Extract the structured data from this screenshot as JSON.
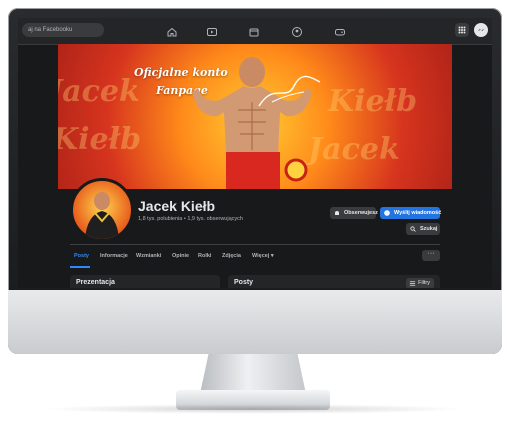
{
  "topbar": {
    "search_placeholder": "aj na Facebooku",
    "nav_icons": [
      "home-icon",
      "watch-icon",
      "marketplace-icon",
      "groups-icon",
      "gaming-icon"
    ],
    "right_icons": [
      "menu-grid-icon",
      "messenger-icon"
    ]
  },
  "cover": {
    "tagline_line1": "Oficjalne konto",
    "tagline_line2": "Fanpage",
    "background_words": [
      "Jacek",
      "Kiełb",
      "Jacek",
      "Kiełb"
    ]
  },
  "profile": {
    "name": "Jacek Kiełb",
    "stats": "1,8 tys. polubienia • 1,9 tys. obserwujących"
  },
  "actions": {
    "follow_label": "Obserwujesz",
    "message_label": "Wyślij wiadomość",
    "search_label": "Szukaj"
  },
  "tabs": [
    {
      "label": "Posty"
    },
    {
      "label": "Informacje"
    },
    {
      "label": "Wzmianki"
    },
    {
      "label": "Opinie"
    },
    {
      "label": "Rolki"
    },
    {
      "label": "Zdjęcia"
    },
    {
      "label": "Więcej ▾"
    }
  ],
  "more_label": "···",
  "panels": {
    "left_title": "Prezentacja",
    "right_title": "Posty",
    "filter_label": "Filtry"
  },
  "colors": {
    "accent": "#2d88ff",
    "message_button": "#2374e1",
    "background": "#18191a"
  }
}
